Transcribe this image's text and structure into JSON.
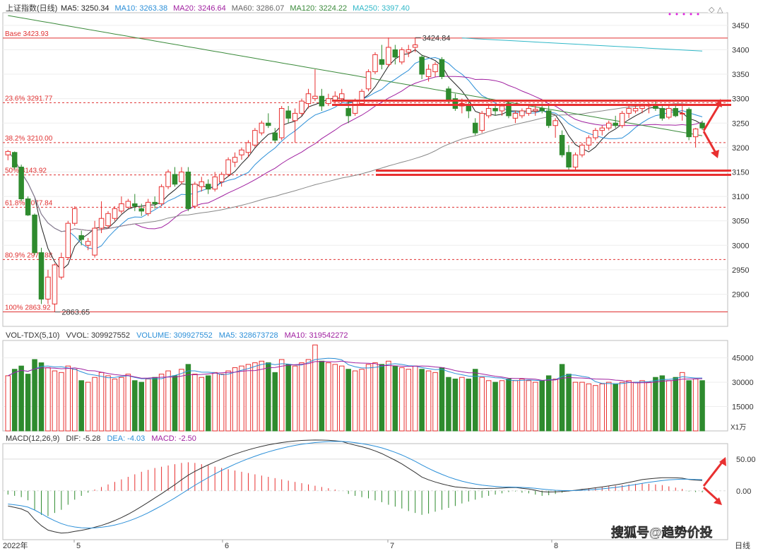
{
  "header": {
    "title": "上证指数(日线)",
    "ma": [
      {
        "label": "MA5: 3250.34",
        "color": "#222222"
      },
      {
        "label": "MA10: 3263.38",
        "color": "#2b8fd8"
      },
      {
        "label": "MA20: 3246.64",
        "color": "#a020a0"
      },
      {
        "label": "MA60: 3286.07",
        "color": "#666666"
      },
      {
        "label": "MA120: 3224.22",
        "color": "#3a8a3a"
      },
      {
        "label": "MA250: 3397.40",
        "color": "#30b8c8"
      }
    ]
  },
  "volume_header": {
    "name": "VOL-TDX(5,10)",
    "vvol": "VVOL: 309927552",
    "volume": "VOLUME: 309927552",
    "ma5": "MA5: 328673728",
    "ma10": "MA10: 319542272"
  },
  "macd_header": {
    "name": "MACD(12,26,9)",
    "dif": "DIF: -5.28",
    "dea": "DEA: -4.03",
    "macd": "MACD: -2.50"
  },
  "watermark": "搜狐号@趋势价投",
  "vol_unit": "X1万",
  "colors": {
    "up": "#e83030",
    "down": "#2e8b2e",
    "ma5": "#222222",
    "ma10": "#2b8fd8",
    "ma20": "#a020a0",
    "ma60": "#888888",
    "ma120": "#3a8a3a",
    "ma250": "#30b8c8",
    "fib": "#e03030"
  },
  "chart_data": {
    "type": "candlestick",
    "price_axis": {
      "min": 2840,
      "max": 3470,
      "ticks": [
        2900,
        2950,
        3000,
        3050,
        3100,
        3150,
        3200,
        3250,
        3300,
        3350,
        3400,
        3450
      ]
    },
    "volume_axis": {
      "max": 54000,
      "ticks": [
        15000,
        30000,
        45000
      ],
      "unit": "X1万"
    },
    "macd_axis": {
      "min": -75,
      "max": 70,
      "ticks": [
        0.0,
        50.0
      ],
      "tick_labels": [
        "0.00",
        "50.00"
      ]
    },
    "x_labels": [
      "2022年",
      "5",
      "6",
      "7",
      "8",
      "日线"
    ],
    "fib_levels": [
      {
        "label": "Base 3423.93",
        "value": 3423.93
      },
      {
        "label": "23.6% 3291.77",
        "value": 3291.77
      },
      {
        "label": "38.2% 3210.00",
        "value": 3210.0
      },
      {
        "label": "50% 3143.92",
        "value": 3143.92
      },
      {
        "label": "61.8% 3077.84",
        "value": 3077.84
      },
      {
        "label": "80.9% 2970.88",
        "value": 2970.88
      },
      {
        "label": "100% 2863.92",
        "value": 2863.92
      }
    ],
    "annotations": [
      {
        "label": "3424.84",
        "value": 3424.84
      },
      {
        "label": "2863.65",
        "value": 2863.65
      }
    ],
    "candles": [
      [
        3185,
        3195,
        3174,
        3192
      ],
      [
        3190,
        3192,
        3155,
        3160
      ],
      [
        3160,
        3165,
        3090,
        3095
      ],
      [
        3095,
        3100,
        3060,
        3062
      ],
      [
        3062,
        3065,
        2980,
        2985
      ],
      [
        2985,
        2995,
        2880,
        2890
      ],
      [
        2890,
        2950,
        2880,
        2935
      ],
      [
        2880,
        2963,
        2864,
        2960
      ],
      [
        2935,
        2985,
        2930,
        2975
      ],
      [
        2975,
        3050,
        2970,
        3045
      ],
      [
        3045,
        3080,
        3040,
        3075
      ],
      [
        3020,
        3030,
        3000,
        3012
      ],
      [
        3000,
        3015,
        2990,
        3008
      ],
      [
        2980,
        3050,
        2975,
        3035
      ],
      [
        3035,
        3090,
        3025,
        3055
      ],
      [
        3040,
        3070,
        3035,
        3065
      ],
      [
        3055,
        3080,
        3050,
        3075
      ],
      [
        3070,
        3100,
        3065,
        3085
      ],
      [
        3078,
        3095,
        3075,
        3090
      ],
      [
        3085,
        3105,
        3070,
        3080
      ],
      [
        3075,
        3085,
        3060,
        3070
      ],
      [
        3065,
        3095,
        3060,
        3088
      ],
      [
        3088,
        3100,
        3075,
        3085
      ],
      [
        3085,
        3125,
        3080,
        3120
      ],
      [
        3120,
        3155,
        3115,
        3150
      ],
      [
        3145,
        3160,
        3120,
        3125
      ],
      [
        3130,
        3160,
        3125,
        3150
      ],
      [
        3150,
        3160,
        3070,
        3075
      ],
      [
        3080,
        3130,
        3075,
        3125
      ],
      [
        3120,
        3140,
        3110,
        3130
      ],
      [
        3125,
        3135,
        3105,
        3115
      ],
      [
        3115,
        3150,
        3110,
        3140
      ],
      [
        3130,
        3150,
        3120,
        3145
      ],
      [
        3145,
        3180,
        3140,
        3175
      ],
      [
        3170,
        3190,
        3160,
        3180
      ],
      [
        3185,
        3200,
        3175,
        3195
      ],
      [
        3190,
        3215,
        3180,
        3210
      ],
      [
        3205,
        3240,
        3200,
        3235
      ],
      [
        3230,
        3255,
        3225,
        3250
      ],
      [
        3250,
        3270,
        3240,
        3245
      ],
      [
        3230,
        3240,
        3210,
        3215
      ],
      [
        3220,
        3285,
        3215,
        3280
      ],
      [
        3275,
        3285,
        3250,
        3260
      ],
      [
        3255,
        3280,
        3210,
        3270
      ],
      [
        3270,
        3300,
        3265,
        3295
      ],
      [
        3290,
        3320,
        3280,
        3310
      ],
      [
        3300,
        3360,
        3295,
        3305
      ],
      [
        3305,
        3320,
        3275,
        3285
      ],
      [
        3290,
        3310,
        3285,
        3300
      ],
      [
        3295,
        3315,
        3290,
        3305
      ],
      [
        3300,
        3320,
        3290,
        3310
      ],
      [
        3280,
        3295,
        3250,
        3265
      ],
      [
        3270,
        3300,
        3265,
        3295
      ],
      [
        3290,
        3320,
        3285,
        3315
      ],
      [
        3320,
        3360,
        3315,
        3355
      ],
      [
        3355,
        3395,
        3350,
        3390
      ],
      [
        3380,
        3410,
        3360,
        3370
      ],
      [
        3370,
        3425,
        3365,
        3405
      ],
      [
        3400,
        3410,
        3370,
        3385
      ],
      [
        3375,
        3405,
        3370,
        3400
      ],
      [
        3395,
        3410,
        3385,
        3400
      ],
      [
        3405,
        3425,
        3395,
        3410
      ],
      [
        3385,
        3390,
        3340,
        3350
      ],
      [
        3345,
        3370,
        3335,
        3360
      ],
      [
        3355,
        3375,
        3345,
        3370
      ],
      [
        3380,
        3385,
        3340,
        3345
      ],
      [
        3320,
        3325,
        3290,
        3295
      ],
      [
        3300,
        3310,
        3275,
        3280
      ],
      [
        3285,
        3300,
        3270,
        3290
      ],
      [
        3285,
        3295,
        3260,
        3275
      ],
      [
        3250,
        3260,
        3225,
        3230
      ],
      [
        3235,
        3275,
        3230,
        3270
      ],
      [
        3265,
        3290,
        3260,
        3280
      ],
      [
        3280,
        3285,
        3265,
        3275
      ],
      [
        3275,
        3290,
        3265,
        3285
      ],
      [
        3290,
        3295,
        3260,
        3265
      ],
      [
        3260,
        3275,
        3250,
        3270
      ],
      [
        3265,
        3280,
        3260,
        3275
      ],
      [
        3270,
        3285,
        3265,
        3280
      ],
      [
        3275,
        3285,
        3265,
        3278
      ],
      [
        3280,
        3290,
        3270,
        3275
      ],
      [
        3275,
        3285,
        3240,
        3245
      ],
      [
        3245,
        3260,
        3220,
        3255
      ],
      [
        3225,
        3235,
        3180,
        3185
      ],
      [
        3190,
        3205,
        3155,
        3160
      ],
      [
        3160,
        3190,
        3155,
        3185
      ],
      [
        3185,
        3210,
        3180,
        3205
      ],
      [
        3205,
        3225,
        3195,
        3220
      ],
      [
        3220,
        3240,
        3215,
        3235
      ],
      [
        3235,
        3245,
        3225,
        3240
      ],
      [
        3240,
        3255,
        3235,
        3250
      ],
      [
        3250,
        3265,
        3240,
        3245
      ],
      [
        3245,
        3275,
        3240,
        3270
      ],
      [
        3270,
        3285,
        3260,
        3280
      ],
      [
        3275,
        3285,
        3270,
        3280
      ],
      [
        3280,
        3290,
        3270,
        3285
      ],
      [
        3285,
        3292,
        3270,
        3288
      ],
      [
        3288,
        3295,
        3275,
        3280
      ],
      [
        3280,
        3285,
        3255,
        3260
      ],
      [
        3262,
        3285,
        3258,
        3280
      ],
      [
        3280,
        3290,
        3262,
        3265
      ],
      [
        3270,
        3285,
        3255,
        3270
      ],
      [
        3278,
        3282,
        3215,
        3222
      ],
      [
        3222,
        3240,
        3200,
        3238
      ],
      [
        3250,
        3255,
        3236,
        3240
      ]
    ],
    "volume": [
      34000,
      38000,
      40000,
      35000,
      44000,
      42000,
      39000,
      37000,
      36000,
      40000,
      38000,
      31000,
      30000,
      33000,
      36000,
      34000,
      32000,
      33000,
      35000,
      31000,
      30000,
      32000,
      33000,
      35000,
      37000,
      34000,
      38000,
      41000,
      35000,
      33000,
      34000,
      36000,
      35000,
      37000,
      39000,
      40000,
      41000,
      42000,
      43000,
      42000,
      36000,
      44000,
      41000,
      40000,
      42000,
      44000,
      53000,
      43000,
      42000,
      41000,
      40000,
      38000,
      37000,
      38000,
      41000,
      42000,
      41000,
      43000,
      40000,
      39000,
      38000,
      40000,
      38000,
      37000,
      36000,
      39000,
      33000,
      32000,
      33000,
      32000,
      38000,
      33000,
      31000,
      30000,
      31000,
      32000,
      31000,
      32000,
      31000,
      30000,
      31000,
      34000,
      32000,
      41000,
      35000,
      30000,
      30000,
      29000,
      28000,
      29000,
      30000,
      29000,
      30000,
      31000,
      30000,
      31000,
      30000,
      33000,
      34000,
      31000,
      33000,
      36000,
      31000,
      32000,
      31000
    ],
    "macd_hist": [
      -6,
      -8,
      -10,
      -15,
      -30,
      -38,
      -40,
      -35,
      -30,
      -22,
      -14,
      -8,
      -3,
      2,
      6,
      10,
      14,
      18,
      22,
      26,
      30,
      33,
      36,
      38,
      40,
      42,
      44,
      45,
      44,
      42,
      40,
      38,
      36,
      34,
      32,
      30,
      28,
      26,
      24,
      22,
      20,
      18,
      16,
      14,
      12,
      10,
      8,
      6,
      4,
      2,
      0,
      -5,
      -8,
      -10,
      -12,
      -15,
      -18,
      -22,
      -25,
      -28,
      -32,
      -35,
      -38,
      -36,
      -33,
      -30,
      -27,
      -24,
      -20,
      -17,
      -14,
      -11,
      -8,
      -6,
      -4,
      -2,
      -1,
      -3,
      -4,
      -6,
      -8,
      -7,
      -5,
      -3,
      -1,
      1,
      3,
      4,
      5,
      6,
      7,
      8,
      9,
      10,
      11,
      12,
      11,
      10,
      9,
      7,
      5,
      3,
      -1,
      -2,
      -2.5
    ]
  }
}
